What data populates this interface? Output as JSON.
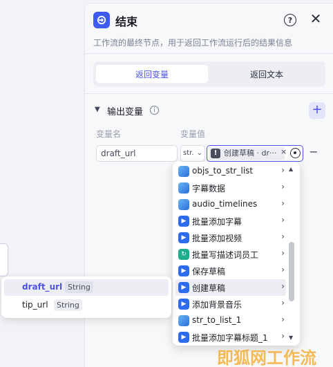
{
  "header": {
    "title": "结束",
    "description": "工作流的最终节点，用于返回工作流运行后的结果信息",
    "help_glyph": "?",
    "close_glyph": "✕"
  },
  "tabs": [
    {
      "label": "返回变量",
      "active": true
    },
    {
      "label": "返回文本",
      "active": false
    }
  ],
  "output_section": {
    "title": "输出变量",
    "info_glyph": "i",
    "add_glyph": "+",
    "column_name": "变量名",
    "column_value": "变量值",
    "row": {
      "name_value": "draft_url",
      "type_value": "str.",
      "ref_tag": "创建草稿 · dr···",
      "ref_icon_glyph": "!",
      "remove_tag_glyph": "×",
      "delete_glyph": "−"
    }
  },
  "node_dropdown": {
    "items": [
      {
        "label": "objs_to_str_list",
        "icon": "plugin-icon"
      },
      {
        "label": "字幕数据",
        "icon": "plugin-icon"
      },
      {
        "label": "audio_timelines",
        "icon": "plugin-icon"
      },
      {
        "label": "批量添加字幕",
        "icon": "flow-icon"
      },
      {
        "label": "批量添加视频",
        "icon": "flow-icon"
      },
      {
        "label": "批量写描述词员工",
        "icon": "cycle-icon"
      },
      {
        "label": "保存草稿",
        "icon": "flow-icon"
      },
      {
        "label": "创建草稿",
        "icon": "flow-icon",
        "highlighted": true
      },
      {
        "label": "添加背景音乐",
        "icon": "flow-icon"
      },
      {
        "label": "str_to_list_1",
        "icon": "plugin-icon"
      },
      {
        "label": "批量添加字幕标题_1",
        "icon": "flow-icon"
      }
    ],
    "arrow_glyph": "›",
    "scroll_up_glyph": "▲",
    "scroll_down_glyph": "▼"
  },
  "variable_popup": {
    "items": [
      {
        "name": "draft_url",
        "type": "String",
        "selected": true
      },
      {
        "name": "tip_url",
        "type": "String",
        "selected": false
      }
    ]
  },
  "watermark": "即狐网工作流",
  "colors": {
    "accent": "#4d53e8",
    "header_icon": "#3e5bf2",
    "watermark": "#f5a623"
  }
}
